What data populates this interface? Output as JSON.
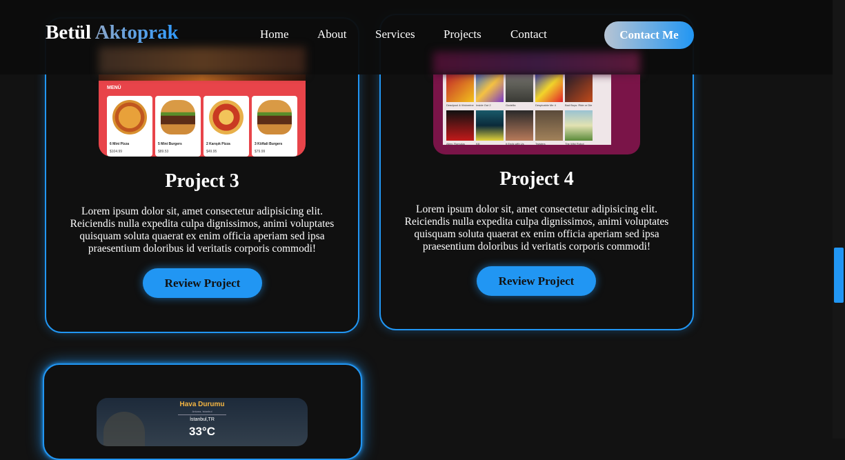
{
  "header": {
    "logo_first": "Betül",
    "logo_last": "Aktoprak",
    "nav": [
      "Home",
      "About",
      "Services",
      "Projects",
      "Contact"
    ],
    "cta": "Contact Me"
  },
  "projects": [
    {
      "title": "Project 3",
      "description": "Lorem ipsum dolor sit, amet consectetur adipisicing elit. Reiciendis nulla expedita culpa dignissimos, animi voluptates quisquam soluta quaerat ex enim officia aperiam sed ipsa praesentium doloribus id veritatis corporis commodi!",
      "button": "Review Project",
      "preview": {
        "section": "MENÜ",
        "items": [
          {
            "name": "6 Mini Pizza",
            "price": "$104.99"
          },
          {
            "name": "5 Mini Burgers",
            "price": "$89.53"
          },
          {
            "name": "2 Karışık Pizza",
            "price": "$49.95"
          },
          {
            "name": "3 Köftali Burgers",
            "price": "$79.99"
          }
        ]
      }
    },
    {
      "title": "Project 4",
      "description": "Lorem ipsum dolor sit, amet consectetur adipisicing elit. Reiciendis nulla expedita culpa dignissimos, animi voluptates quisquam soluta quaerat ex enim officia aperiam sed ipsa praesentium doloribus id veritatis corporis commodi!",
      "button": "Review Project",
      "preview": {
        "posters_row1": [
          "Deadpool & Wolverine",
          "Inside Out 2",
          "Godzilla",
          "Despicable Me 4",
          "Bad Boys: Ride or Die"
        ],
        "posters_row2": [
          "Alien: Romulus",
          "Kill",
          "It Ends with Us",
          "Twisters",
          "The Wild Robot"
        ]
      }
    },
    {
      "preview": {
        "title": "Hava Durumu",
        "subtitle": "Ankara, Istanbul",
        "city": "İstanbul,TR",
        "temp": "33°C"
      }
    }
  ],
  "colors": {
    "accent": "#2196f3",
    "background": "#121212",
    "header": "#0c0c0c"
  }
}
